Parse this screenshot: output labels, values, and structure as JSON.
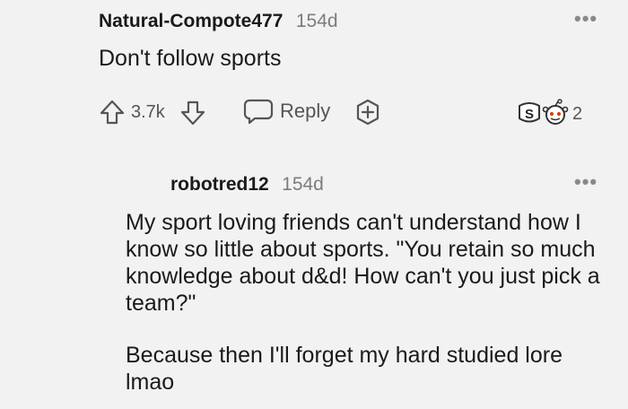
{
  "comment": {
    "username": "Natural-Compote477",
    "age": "154d",
    "body": "Don't follow sports",
    "vote_count": "3.7k",
    "reply_label": "Reply",
    "award_count": "2"
  },
  "reply": {
    "username": "robotred12",
    "age": "154d",
    "paragraph1": "My sport loving friends can't understand how I know so little about sports. \"You retain so much knowledge about d&d! How can't you just pick a team?\"",
    "paragraph2": "Because then I'll forget my hard studied lore lmao"
  },
  "colors": {
    "background": "#f2f2f2",
    "text": "#1a1a1b",
    "muted": "#7c7c7c"
  }
}
